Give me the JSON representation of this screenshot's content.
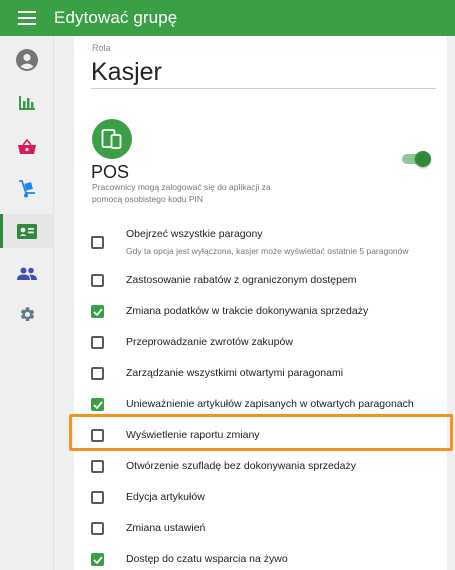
{
  "header": {
    "title": "Edytować grupę",
    "menu_icon": "hamburger-menu-icon",
    "color": "#3b9f45"
  },
  "sidebar": {
    "items": [
      {
        "name": "user-icon",
        "active": false
      },
      {
        "name": "bar-chart-icon",
        "active": false
      },
      {
        "name": "basket-icon",
        "active": false
      },
      {
        "name": "delivery-icon",
        "active": false
      },
      {
        "name": "id-card-icon",
        "active": true
      },
      {
        "name": "people-icon",
        "active": false
      },
      {
        "name": "gear-icon",
        "active": false
      }
    ],
    "colors": {
      "user": "#757575",
      "chart": "#3b9f45",
      "basket": "#d81b60",
      "delivery": "#1e88e5",
      "idcard": "#2f8a3a",
      "people": "#3f51b5",
      "gear": "#607d8b"
    }
  },
  "role": {
    "label": "Rola",
    "value": "Kasjer"
  },
  "pos": {
    "title": "POS",
    "description": "Pracownicy mogą zalogować się do aplikacji za pomocą osobistego kodu PIN",
    "enabled": true
  },
  "permissions": [
    {
      "label": "Obejrzeć wszystkie paragony",
      "sub": "Gdy ta opcja jest wyłączona, kasjer może wyświetlać ostatnie 5 paragonów",
      "checked": false
    },
    {
      "label": "Zastosowanie rabatów z ograniczonym dostępem",
      "checked": false
    },
    {
      "label": "Zmiana podatków w trakcie dokonywania sprzedaży",
      "checked": true
    },
    {
      "label": "Przeprowadzanie zwrotów zakupów",
      "checked": false
    },
    {
      "label": "Zarządzanie wszystkimi otwartymi paragonami",
      "checked": false
    },
    {
      "label": "Unieważnienie artykułów zapisanych w otwartych paragonach",
      "checked": true
    },
    {
      "label": "Wyświetlenie raportu zmiany",
      "checked": false,
      "highlighted": true
    },
    {
      "label": "Otwórzenie szufladę bez dokonywania sprzedaży",
      "checked": false
    },
    {
      "label": "Edycja artykułów",
      "checked": false
    },
    {
      "label": "Zmiana ustawień",
      "checked": false
    },
    {
      "label": "Dostęp do czatu wsparcia na żywo",
      "checked": true
    }
  ],
  "highlight_color": "#f29422"
}
